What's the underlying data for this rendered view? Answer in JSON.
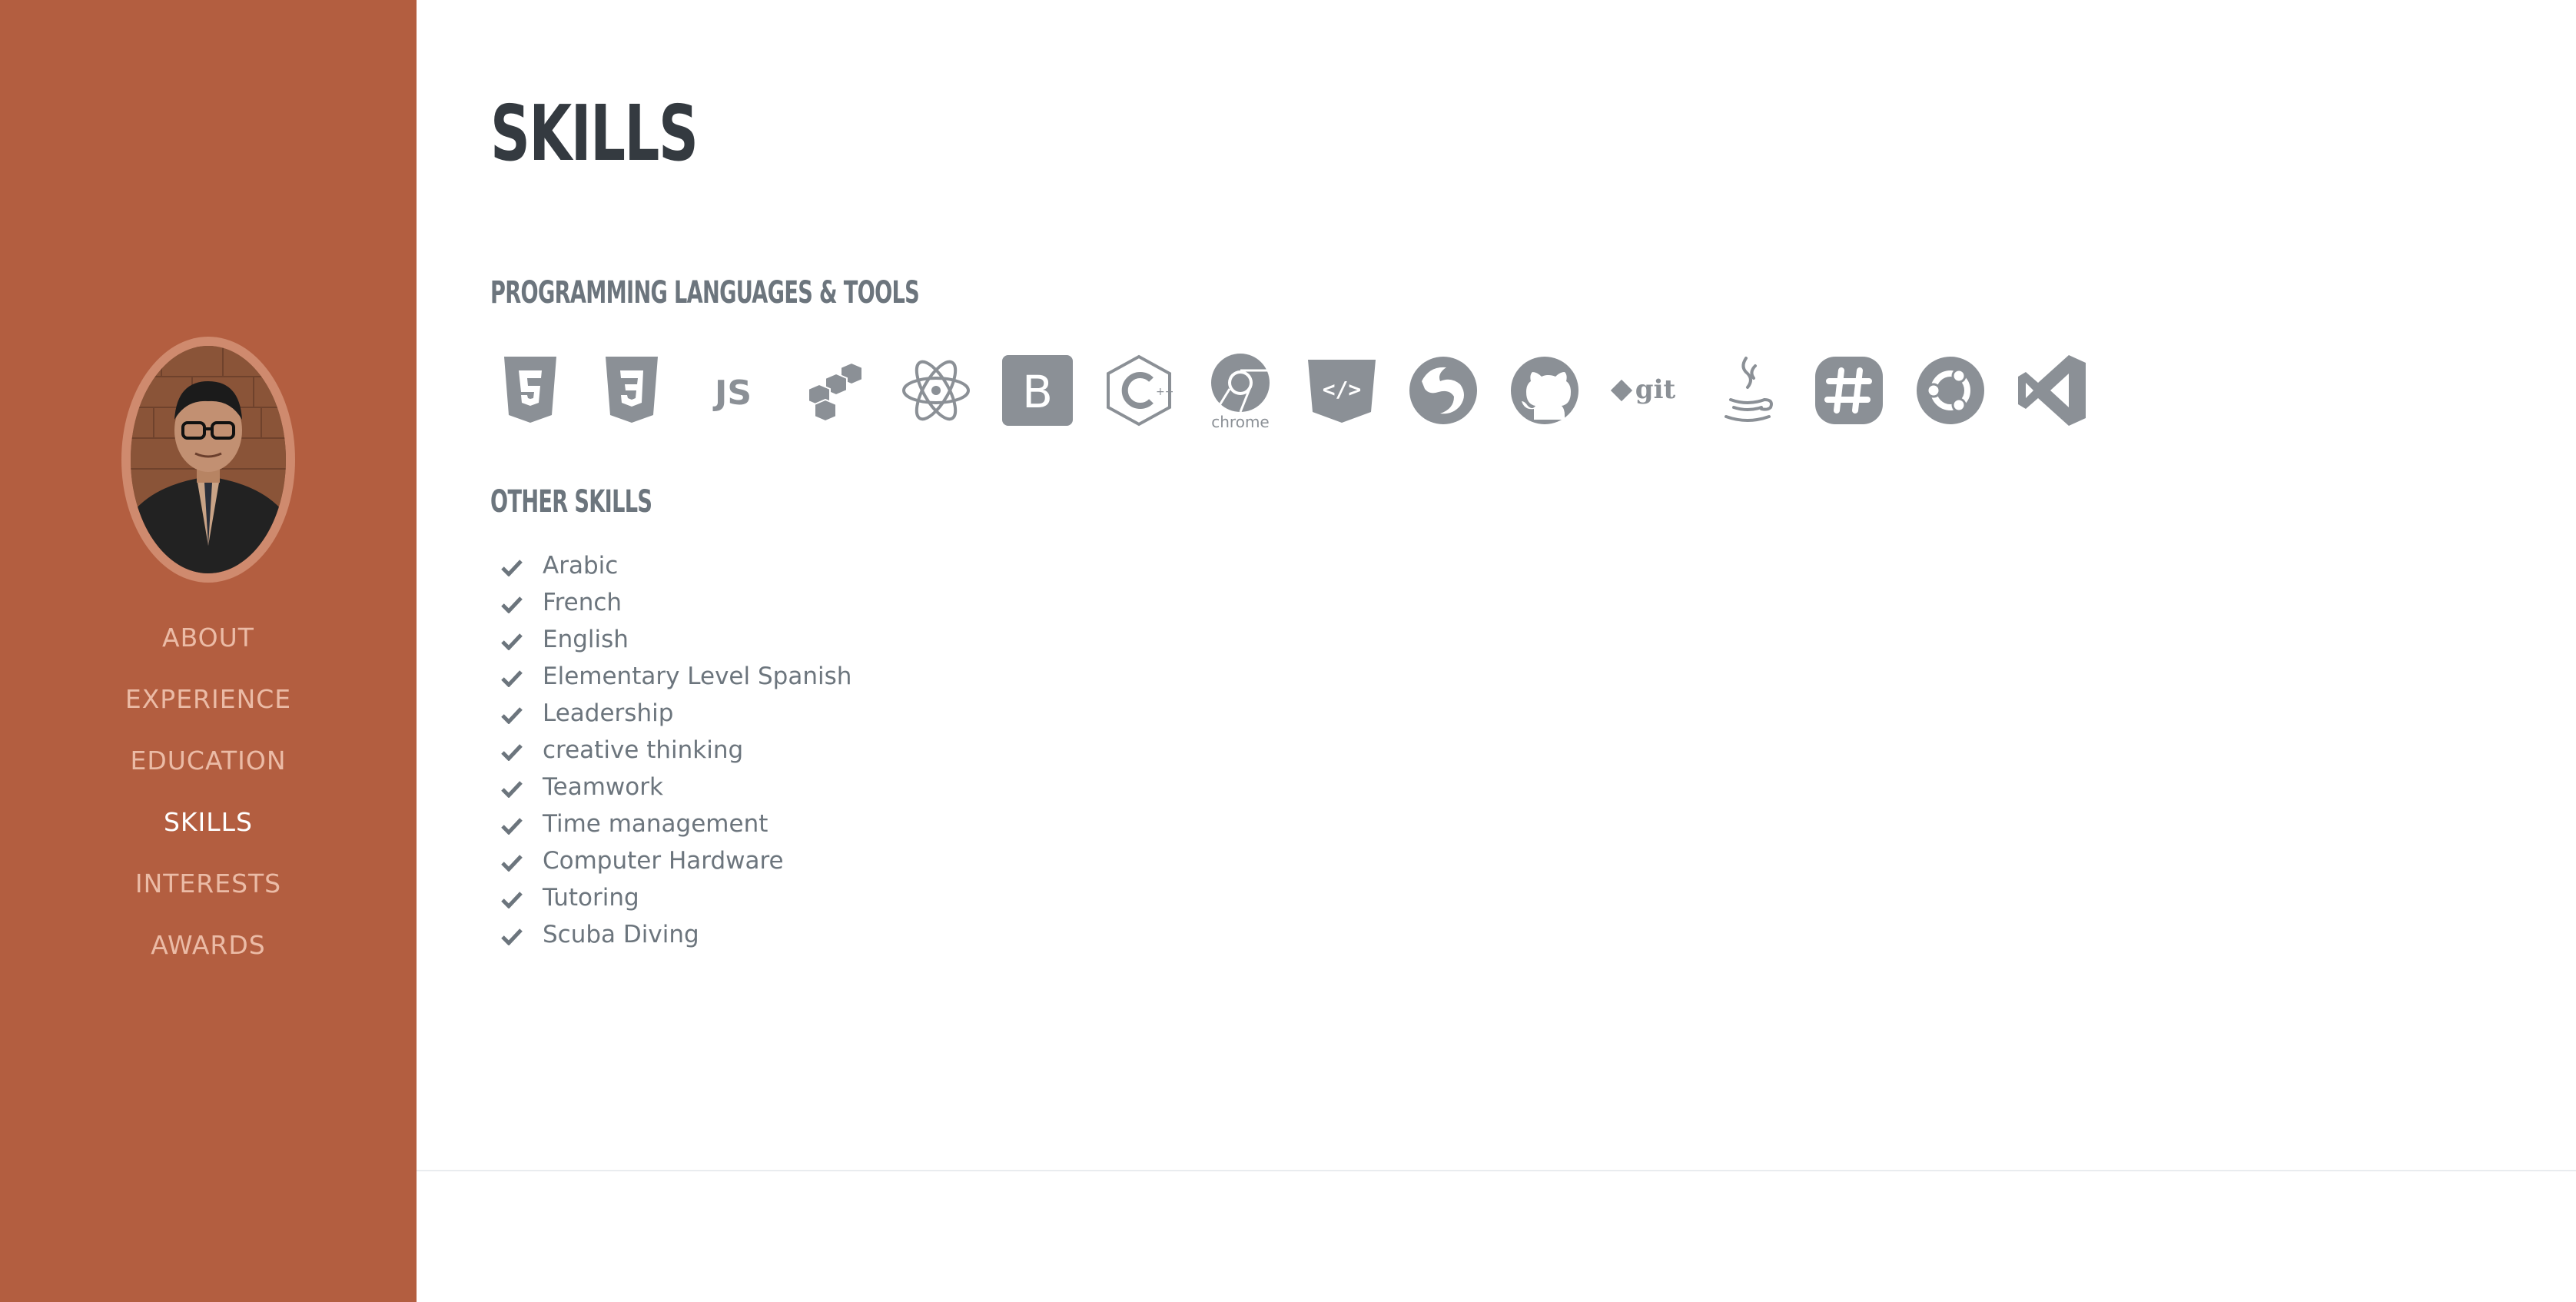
{
  "sidebar": {
    "nav": [
      {
        "label": "ABOUT"
      },
      {
        "label": "EXPERIENCE"
      },
      {
        "label": "EDUCATION"
      },
      {
        "label": "SKILLS"
      },
      {
        "label": "INTERESTS"
      },
      {
        "label": "AWARDS"
      }
    ],
    "active": "SKILLS"
  },
  "main": {
    "title": "SKILLS",
    "tools_heading": "PROGRAMMING LANGUAGES & TOOLS",
    "other_heading": "OTHER SKILLS",
    "tools": [
      "html5-icon",
      "css3-icon",
      "js-icon",
      "aws-icon",
      "atom-icon",
      "bootstrap-icon",
      "cplusplus-icon",
      "chrome-icon",
      "codepen-icon",
      "firefox-icon",
      "github-icon",
      "git-icon",
      "java-icon",
      "slack-icon",
      "ubuntu-icon",
      "vscode-icon"
    ],
    "chrome_label": "chrome",
    "git_label": "git",
    "skills": [
      "Arabic",
      "French",
      "English",
      "Elementary Level Spanish",
      "Leadership",
      "creative thinking",
      "Teamwork",
      "Time management",
      "Computer Hardware",
      "Tutoring",
      "Scuba Diving"
    ]
  },
  "colors": {
    "sidebar": "#b35e40",
    "nav_text": "#ebbba6",
    "nav_active": "#ffffff",
    "heading": "#343a40",
    "muted": "#6c757d",
    "icon": "#8b9096"
  }
}
